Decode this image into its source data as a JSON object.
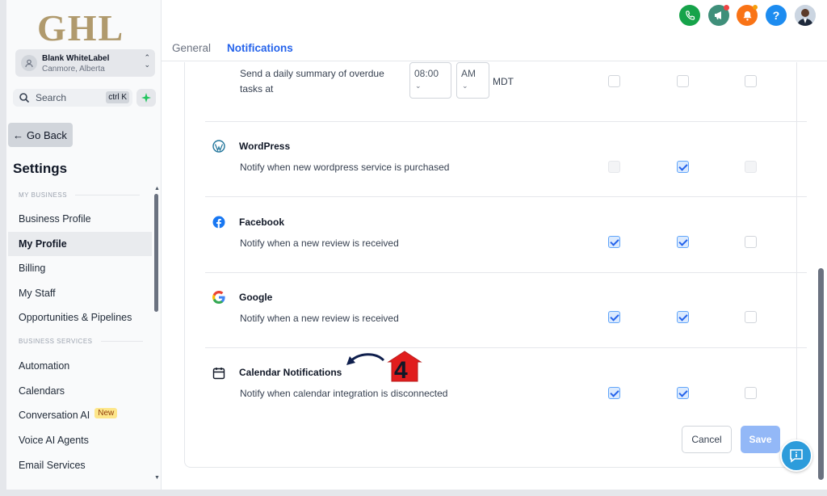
{
  "brand": {
    "logo_text": "GHL"
  },
  "account": {
    "name": "Blank WhiteLabel",
    "location": "Canmore, Alberta"
  },
  "search": {
    "label": "Search",
    "shortcut": "ctrl K"
  },
  "sidebar": {
    "go_back": "Go Back",
    "title": "Settings",
    "section_my_business": "MY BUSINESS",
    "section_business_services": "BUSINESS SERVICES",
    "items": [
      {
        "label": "Business Profile"
      },
      {
        "label": "My Profile"
      },
      {
        "label": "Billing"
      },
      {
        "label": "My Staff"
      },
      {
        "label": "Opportunities & Pipelines"
      },
      {
        "label": "Automation"
      },
      {
        "label": "Calendars"
      },
      {
        "label": "Conversation AI",
        "badge": "New"
      },
      {
        "label": "Voice AI Agents"
      },
      {
        "label": "Email Services"
      }
    ]
  },
  "header": {
    "tabs": [
      {
        "label": "General"
      },
      {
        "label": "Notifications"
      }
    ],
    "help_label": "?"
  },
  "notifications": {
    "daily_summary": {
      "text": "Send a daily summary of overdue tasks at",
      "time": "08:00",
      "ampm": "AM",
      "timezone": "MDT",
      "checks": [
        false,
        false,
        false
      ]
    },
    "rows": [
      {
        "title": "WordPress",
        "desc": "Notify when new wordpress service is purchased",
        "icon": "wordpress-icon",
        "checks": [
          "disabled",
          "checked",
          "disabled"
        ]
      },
      {
        "title": "Facebook",
        "desc": "Notify when a new review is received",
        "icon": "facebook-icon",
        "checks": [
          "checked",
          "checked",
          "unchecked"
        ]
      },
      {
        "title": "Google",
        "desc": "Notify when a new review is received",
        "icon": "google-icon",
        "checks": [
          "checked",
          "checked",
          "unchecked"
        ]
      },
      {
        "title": "Calendar Notifications",
        "desc": "Notify when calendar integration is disconnected",
        "icon": "calendar-icon",
        "checks": [
          "checked",
          "checked",
          "unchecked"
        ]
      }
    ],
    "cancel_label": "Cancel",
    "save_label": "Save"
  },
  "annotation": {
    "step_number": "4"
  },
  "colors": {
    "accent": "#2563eb",
    "save_disabled": "#93b8f7",
    "annotation": "#e11d1d"
  }
}
